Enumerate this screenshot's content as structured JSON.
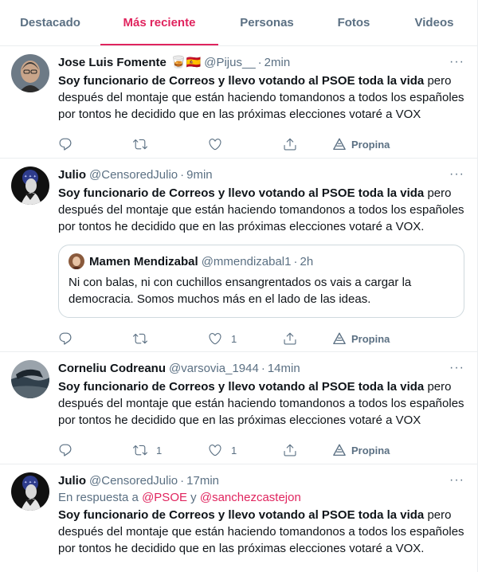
{
  "tabs": [
    {
      "label": "Destacado"
    },
    {
      "label": "Más reciente"
    },
    {
      "label": "Personas"
    },
    {
      "label": "Fotos"
    },
    {
      "label": "Videos"
    }
  ],
  "active_tab_color": "#e0245e",
  "tweets": [
    {
      "name": "Jose Luis Fomente",
      "emojis": "🥃🇪🇸",
      "handle": "@Pijus__",
      "dot": "·",
      "time": "2min",
      "text_bold": "Soy funcionario de Correos y llevo votando al PSOE toda la vida",
      "text_rest": " pero después del montaje que están haciendo tomandonos a todos los españoles por tontos he decidido que en las próximas elecciones votaré a VOX",
      "reply_count": "",
      "retweet_count": "",
      "like_count": "",
      "promote_label": "Propina"
    },
    {
      "name": "Julio",
      "handle": "@CensoredJulio",
      "dot": "·",
      "time": "9min",
      "text_bold": "Soy funcionario de Correos y llevo votando al PSOE toda la vida",
      "text_rest": " pero después del montaje que están haciendo tomandonos a todos los españoles por tontos he decidido que en las próximas elecciones votaré a VOX.",
      "quote": {
        "name": "Mamen Mendizabal",
        "handle": "@mmendizabal1",
        "dot": "·",
        "time": "2h",
        "text": "Ni con balas, ni con cuchillos ensangrentados os vais a cargar la democracia. Somos muchos más en el lado de las ideas."
      },
      "reply_count": "",
      "retweet_count": "",
      "like_count": "1",
      "promote_label": "Propina"
    },
    {
      "name": "Corneliu Codreanu",
      "handle": "@varsovia_1944",
      "dot": "·",
      "time": "14min",
      "text_bold": "Soy funcionario de Correos y llevo votando al PSOE toda la vida",
      "text_rest": " pero después del montaje que están haciendo tomandonos a todos los españoles por tontos he decidido que en las próximas elecciones votaré a VOX",
      "reply_count": "",
      "retweet_count": "1",
      "like_count": "1",
      "promote_label": "Propina"
    },
    {
      "name": "Julio",
      "handle": "@CensoredJulio",
      "dot": "·",
      "time": "17min",
      "reply_prefix": "En respuesta a ",
      "reply_user1": "@PSOE",
      "reply_and": " y ",
      "reply_user2": "@sanchezcastejon",
      "text_bold": "Soy funcionario de Correos y llevo votando al PSOE toda la vida",
      "text_rest": " pero después del montaje que están haciendo tomandonos a todos los españoles por tontos he decidido que en las próximas elecciones votaré a VOX.",
      "reply_count": "",
      "retweet_count": "",
      "like_count": "",
      "promote_label": ""
    }
  ],
  "more_glyph": "···",
  "icons": {
    "reply": "reply-icon",
    "retweet": "retweet-icon",
    "like": "heart-icon",
    "share": "share-icon",
    "promote": "promote-icon"
  }
}
